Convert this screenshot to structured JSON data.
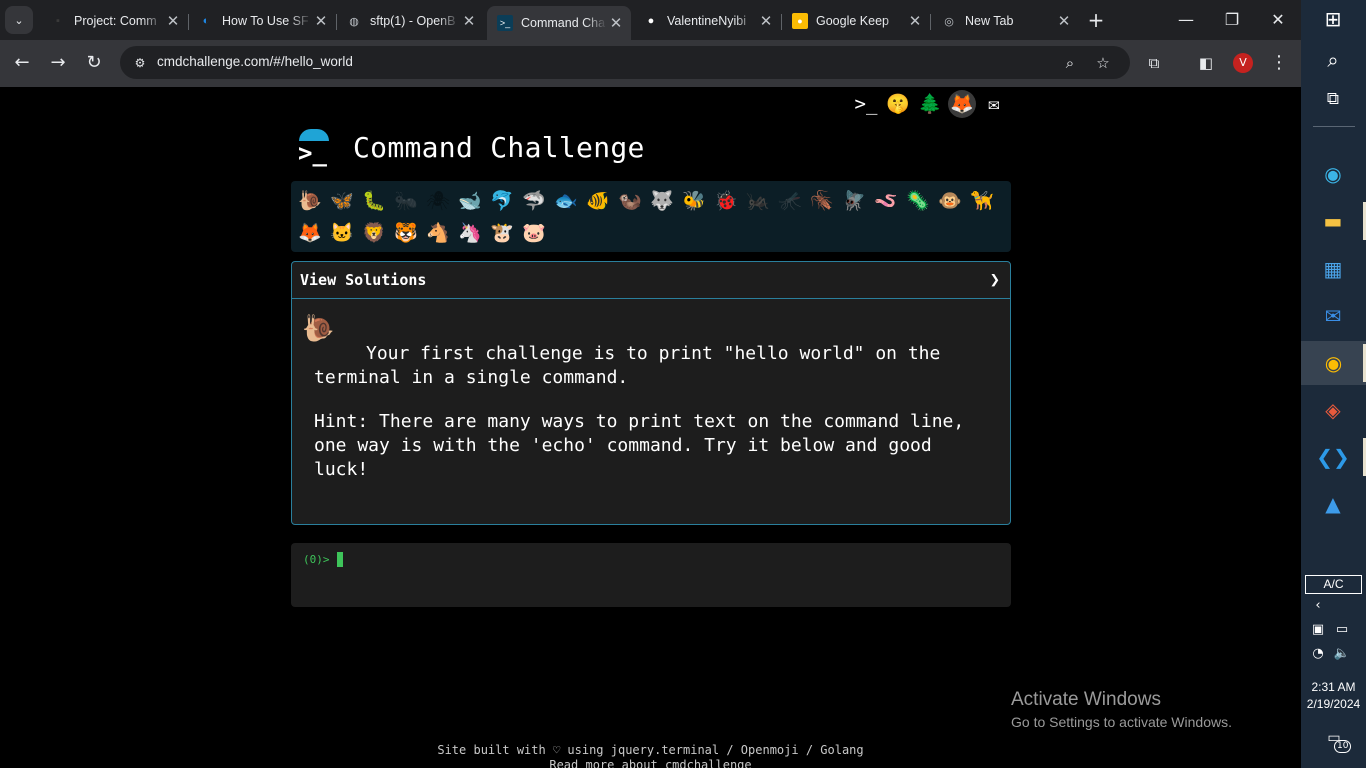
{
  "browser": {
    "tabs": [
      {
        "title": "Project: Comm",
        "icon": "page-icon"
      },
      {
        "title": "How To Use SF",
        "icon": "digitalocean-icon"
      },
      {
        "title": "sftp(1) - OpenB",
        "icon": "globe-icon"
      },
      {
        "title": "Command Cha",
        "icon": "terminal-icon",
        "active": true
      },
      {
        "title": "ValentineNyibi",
        "icon": "github-icon"
      },
      {
        "title": "Google Keep",
        "icon": "keep-icon"
      },
      {
        "title": "New Tab",
        "icon": "chrome-icon"
      }
    ],
    "tab_close_glyph": "✕",
    "new_tab_glyph": "+",
    "url": "cmdchallenge.com/#/hello_world",
    "profile_initial": "V"
  },
  "page": {
    "title": "Command Challenge",
    "top_icons": [
      "terminal-icon",
      "emoji-icon",
      "tree-icon",
      "gitlab-icon",
      "mail-icon"
    ],
    "animals_row1": [
      "🐌",
      "🦋",
      "🐛",
      "🐜",
      "🕷",
      "🐋",
      "🐬",
      "🦈",
      "🐟",
      "🐠",
      "🦦",
      "🐺",
      "🐝",
      "🐞",
      "🦗",
      "🦟",
      "🪳",
      "🪰",
      "🪱",
      "🦠",
      "🐵",
      "🦮"
    ],
    "animals_row2": [
      "🦊",
      "🐱",
      "🦁",
      "🐯",
      "🐴",
      "🦄",
      "🐮",
      "🐷"
    ],
    "view_solutions": "View Solutions",
    "challenge_text": "Your first challenge is to print \"hello world\" on the terminal in a single command.",
    "hint_text": "Hint: There are many ways to print text on the command line, one way is with the 'echo' command. Try it below and good luck!",
    "terminal_prompt": "(0)>",
    "footer_line1": "Site built with ♡ using jquery.terminal / Openmoji / Golang",
    "footer_line2": "Read more about cmdchallenge"
  },
  "watermark": {
    "line1": "Activate Windows",
    "line2": "Go to Settings to activate Windows."
  },
  "taskbar": {
    "ac_label": "A/C",
    "time": "2:31 AM",
    "date": "2/19/2024",
    "notifications": "10"
  },
  "colors": {
    "accent": "#1fa4d6",
    "prompt_green": "#3ec45a",
    "card_border": "#2a7f9c"
  }
}
